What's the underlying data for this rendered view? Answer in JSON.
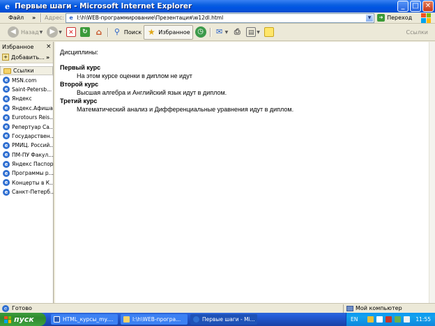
{
  "window": {
    "title": "Первые шаги - Microsoft Internet Explorer",
    "minimize": "_",
    "maximize": "□",
    "close": "✕"
  },
  "menu": {
    "file": "Файл",
    "overflow": "»"
  },
  "address": {
    "label": "Адрес:",
    "value": "I:\\h\\WEB-программирование\\Презентация\\w12dl.html",
    "go_label": "Переход"
  },
  "toolbar": {
    "back_label": "Назад",
    "search_label": "Поиск",
    "favorites_label": "Избранное",
    "links_label": "Ссылки"
  },
  "sidebar": {
    "title": "Избранное",
    "close": "×",
    "add_label": "Добавить...",
    "add_overflow": "»",
    "items": [
      {
        "label": "Ссылки",
        "type": "folder"
      },
      {
        "label": "MSN.com",
        "type": "page"
      },
      {
        "label": "Saint-Petersb...",
        "type": "page"
      },
      {
        "label": "Яндекс",
        "type": "page"
      },
      {
        "label": "Яндекс.Афиша",
        "type": "page"
      },
      {
        "label": "Eurotours Reis...",
        "type": "page"
      },
      {
        "label": "Репертуар Са...",
        "type": "page"
      },
      {
        "label": "Государствен...",
        "type": "page"
      },
      {
        "label": "РМИЦ. Россий...",
        "type": "page"
      },
      {
        "label": "ПМ-ПУ  Факул...",
        "type": "page"
      },
      {
        "label": "Яндекс Паспорт",
        "type": "page"
      },
      {
        "label": "Программы р...",
        "type": "page"
      },
      {
        "label": "Концерты в К...",
        "type": "page"
      },
      {
        "label": "Санкт-Петерб...",
        "type": "page"
      }
    ]
  },
  "content": {
    "heading": "Дисциплины:",
    "courses": [
      {
        "title": "Первый курс",
        "description": "На этом курсе оценки в диплом не идут"
      },
      {
        "title": "Второй курс",
        "description": "Высшая алгебра и Английский язык идут в диплом."
      },
      {
        "title": "Третий курс",
        "description": "Математический анализ и Дифференциальные уравнения идут в диплом."
      }
    ]
  },
  "status": {
    "text": "Готово",
    "zone": "Мой компьютер"
  },
  "taskbar": {
    "start_label": "пуск",
    "tasks": [
      {
        "label": "HTML_курсы_my...."
      },
      {
        "label": "I:\\h\\WEB-програ..."
      },
      {
        "label": "Первые шаги - Mi..."
      }
    ],
    "language": "EN",
    "clock": "11:55"
  },
  "colors": {
    "titlebar": "#0054E3",
    "start": "#3C9C3C",
    "taskbar": "#245EDB"
  }
}
